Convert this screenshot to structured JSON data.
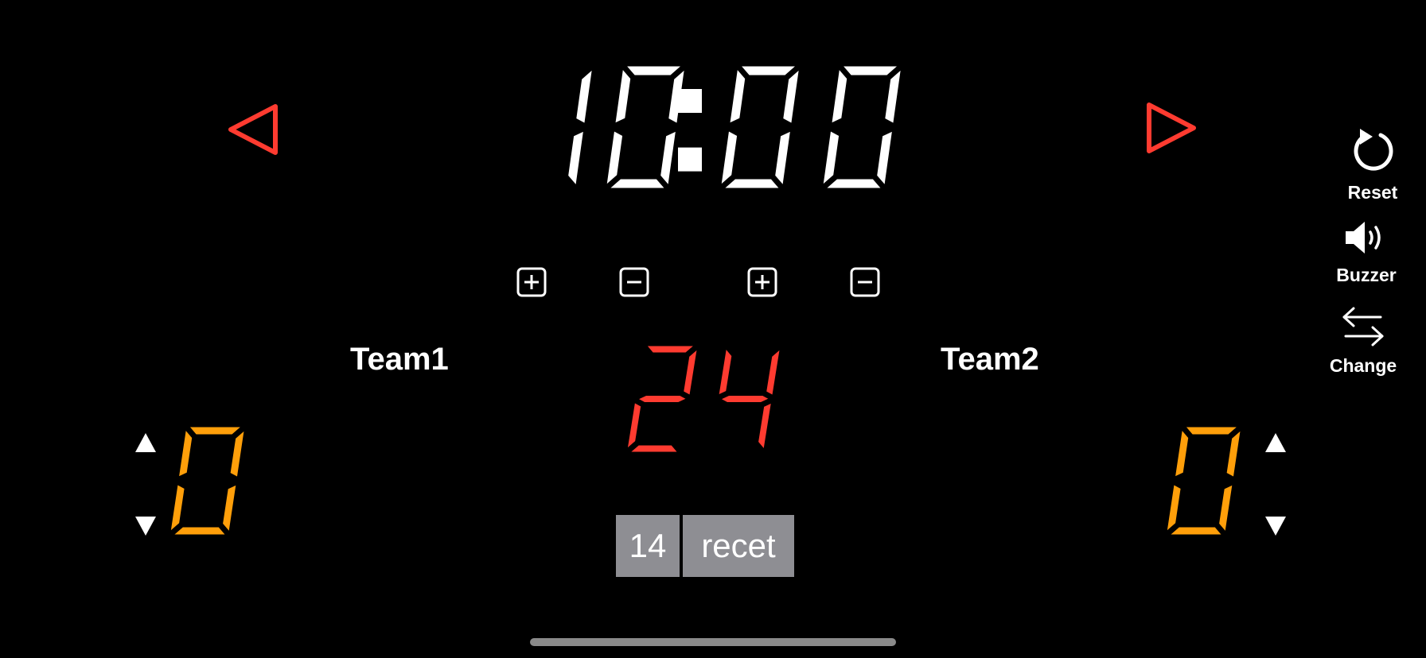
{
  "game_clock": {
    "minutes": "10",
    "seconds": "00",
    "separator": ":"
  },
  "shot_clock": {
    "value": "24"
  },
  "teams": [
    {
      "name": "Team1",
      "score": "0"
    },
    {
      "name": "Team2",
      "score": "0"
    }
  ],
  "shot_clock_buttons": {
    "preset": "14",
    "reset": "recet"
  },
  "side_menu": {
    "reset": "Reset",
    "buzzer": "Buzzer",
    "change": "Change"
  },
  "colors": {
    "clock": "#ffffff",
    "shot_clock": "#ff3b30",
    "score": "#ff9f0a",
    "arrow": "#ff3b30",
    "button_gray": "#8e8e93"
  }
}
